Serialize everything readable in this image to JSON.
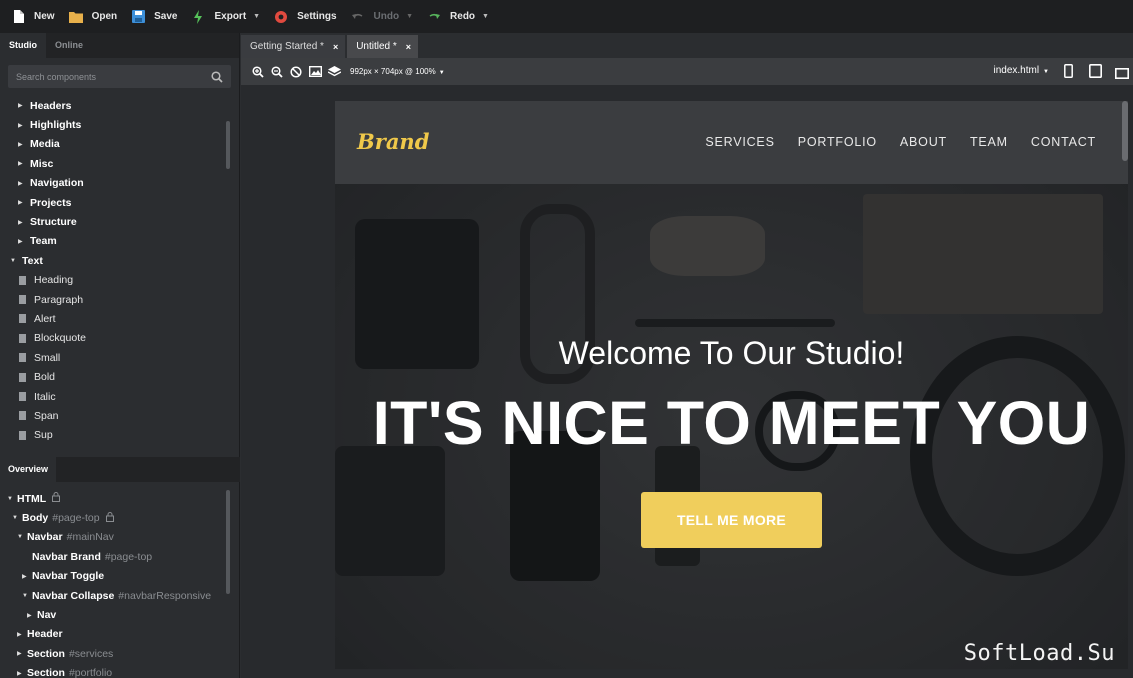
{
  "toolbar": {
    "new": "New",
    "open": "Open",
    "save": "Save",
    "export": "Export",
    "settings": "Settings",
    "undo": "Undo",
    "redo": "Redo"
  },
  "left_tabs": {
    "studio": "Studio",
    "online": "Online"
  },
  "search": {
    "placeholder": "Search components"
  },
  "components": [
    {
      "label": "Headers",
      "kind": "closed"
    },
    {
      "label": "Highlights",
      "kind": "closed"
    },
    {
      "label": "Media",
      "kind": "closed"
    },
    {
      "label": "Misc",
      "kind": "closed"
    },
    {
      "label": "Navigation",
      "kind": "closed"
    },
    {
      "label": "Projects",
      "kind": "closed"
    },
    {
      "label": "Structure",
      "kind": "closed"
    },
    {
      "label": "Team",
      "kind": "closed"
    },
    {
      "label": "Text",
      "kind": "open"
    },
    {
      "label": "Heading",
      "kind": "leaf"
    },
    {
      "label": "Paragraph",
      "kind": "leaf"
    },
    {
      "label": "Alert",
      "kind": "leaf"
    },
    {
      "label": "Blockquote",
      "kind": "leaf"
    },
    {
      "label": "Small",
      "kind": "leaf"
    },
    {
      "label": "Bold",
      "kind": "leaf"
    },
    {
      "label": "Italic",
      "kind": "leaf"
    },
    {
      "label": "Span",
      "kind": "leaf"
    },
    {
      "label": "Sup",
      "kind": "leaf"
    }
  ],
  "overview": {
    "title": "Overview",
    "nodes": [
      {
        "label": "HTML",
        "id": "",
        "indent": 1,
        "tri": "down",
        "lock": true
      },
      {
        "label": "Body",
        "id": "#page-top",
        "indent": 2,
        "tri": "down",
        "lock": true
      },
      {
        "label": "Navbar",
        "id": "#mainNav",
        "indent": 3,
        "tri": "down",
        "lock": false
      },
      {
        "label": "Navbar Brand",
        "id": "#page-top",
        "indent": 4,
        "tri": "none",
        "lock": false
      },
      {
        "label": "Navbar Toggle",
        "id": "",
        "indent": 4,
        "tri": "right",
        "lock": false
      },
      {
        "label": "Navbar Collapse",
        "id": "#navbarResponsive",
        "indent": 4,
        "tri": "down",
        "lock": false
      },
      {
        "label": "Nav",
        "id": "",
        "indent": 5,
        "tri": "right",
        "lock": false
      },
      {
        "label": "Header",
        "id": "",
        "indent": 3,
        "tri": "right",
        "lock": false
      },
      {
        "label": "Section",
        "id": "#services",
        "indent": 3,
        "tri": "right",
        "lock": false
      },
      {
        "label": "Section",
        "id": "#portfolio",
        "indent": 3,
        "tri": "right",
        "lock": false
      }
    ]
  },
  "editor_tabs": [
    {
      "label": "Getting Started *",
      "active": false
    },
    {
      "label": "Untitled *",
      "active": true
    }
  ],
  "canvas": {
    "size": "992px × 704px @ 100%",
    "file": "index.html"
  },
  "site": {
    "brand": "Brand",
    "nav": [
      "SERVICES",
      "PORTFOLIO",
      "ABOUT",
      "TEAM",
      "CONTACT"
    ],
    "welcome": "Welcome To Our Studio!",
    "headline": "IT'S NICE TO MEET YOU",
    "cta": "TELL ME MORE"
  },
  "watermark": "SoftLoad.Su",
  "colors": {
    "accent": "#f0ce5c",
    "brand": "#f0c94a",
    "toolbar": "#1e1f21",
    "panel": "#2b2d30"
  }
}
